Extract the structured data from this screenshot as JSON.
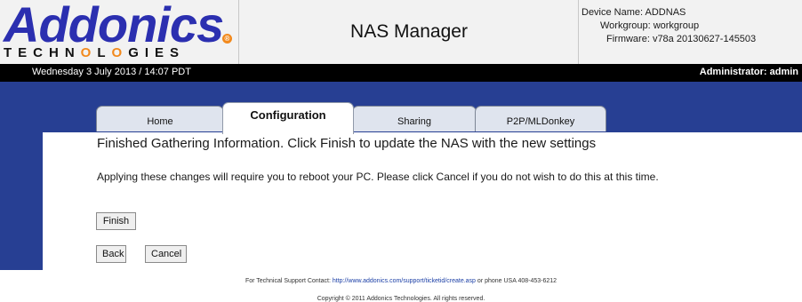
{
  "header": {
    "logo": {
      "word": "Addonics",
      "reg": "R",
      "tagline": "TECHNOLOGIES"
    },
    "app_title": "NAS Manager",
    "device": {
      "name_line": "Device Name: ADDNAS",
      "workgroup_line": "Workgroup: workgroup",
      "firmware_line": "Firmware: v78a 20130627-145503"
    }
  },
  "statusbar": {
    "date": "Wednesday 3 July 2013 / 14:07 PDT",
    "user": "Administrator: admin"
  },
  "tabs": [
    {
      "label": "Home",
      "active": false
    },
    {
      "label": "Configuration",
      "active": true
    },
    {
      "label": "Sharing",
      "active": false
    },
    {
      "label": "P2P/MLDonkey",
      "active": false
    }
  ],
  "content": {
    "heading": "Finished Gathering Information. Click Finish to update the NAS with the new settings",
    "message": "Applying these changes will require you to reboot your PC. Please click Cancel if you do not wish to do this at this time."
  },
  "buttons": {
    "finish": "Finish",
    "back": "Back",
    "cancel": "Cancel"
  },
  "footer": {
    "support_prefix": "For Technical Support Contact:",
    "support_link": "http://www.addonics.com/support/ticketid/create.asp",
    "support_suffix": "or phone USA 408-453-6212",
    "copyright": "Copyright © 2011 Addonics Technologies. All rights reserved."
  },
  "colors": {
    "brand_blue": "#2b2fb0",
    "brand_orange": "#f2891c",
    "nav_blue": "#273f93",
    "status_black": "#000000"
  }
}
